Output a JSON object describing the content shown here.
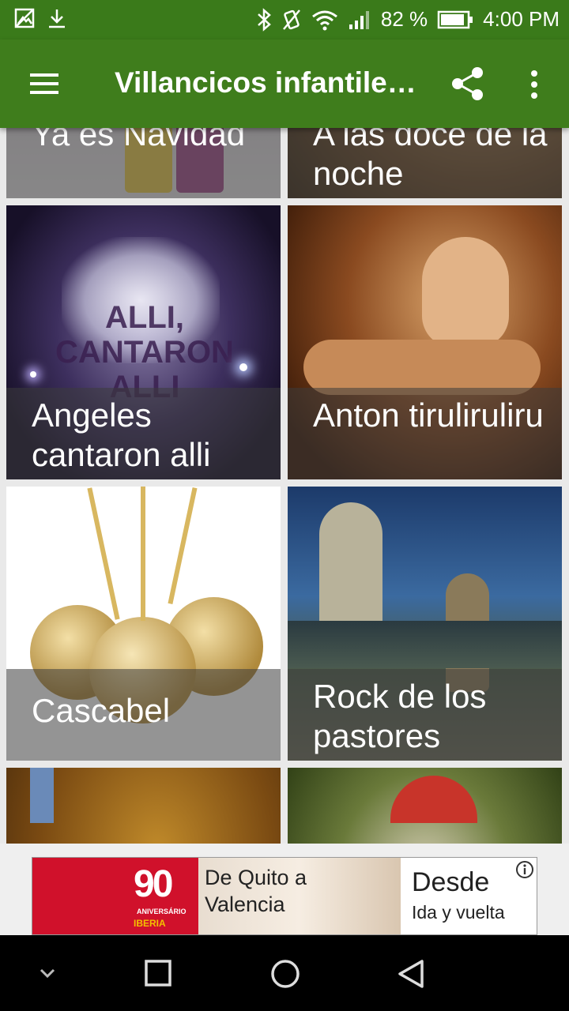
{
  "status_bar": {
    "icons_left": [
      "image-icon",
      "download-icon"
    ],
    "icons_right": [
      "bluetooth-icon",
      "vibrate-icon",
      "wifi-icon",
      "signal-icon"
    ],
    "battery": "82 %",
    "time": "4:00 PM"
  },
  "app_bar": {
    "title": "Villancicos infantile…",
    "menu_icon": "hamburger-menu-icon",
    "share_icon": "share-icon",
    "more_icon": "more-vert-icon"
  },
  "songs": [
    {
      "title": "Ya es Navidad"
    },
    {
      "title": "A las doce de la noche"
    },
    {
      "title": "Angeles cantaron alli",
      "image_text": "ALLI, CANTARON ALLI"
    },
    {
      "title": "Anton tiruliruliru"
    },
    {
      "title": "Cascabel"
    },
    {
      "title": "Rock de los pastores"
    },
    {
      "title": ""
    },
    {
      "title": ""
    }
  ],
  "ad": {
    "logo_number": "90",
    "logo_sub": "ANIVERSÁRIO",
    "logo_brand": "IBERIA",
    "route_text": "De Quito a Valencia",
    "price_label": "Desde",
    "fare_type": "Ida y vuelta",
    "info_icon": "info-icon"
  },
  "nav_bar": {
    "icons": [
      "chevron-down-icon",
      "recents-square-icon",
      "home-circle-icon",
      "back-triangle-icon"
    ]
  },
  "colors": {
    "app_bar": "#3f7d1c",
    "status_bar": "#3a7a1a",
    "ad_brand": "#d0112b",
    "nav_bar": "#000000"
  }
}
